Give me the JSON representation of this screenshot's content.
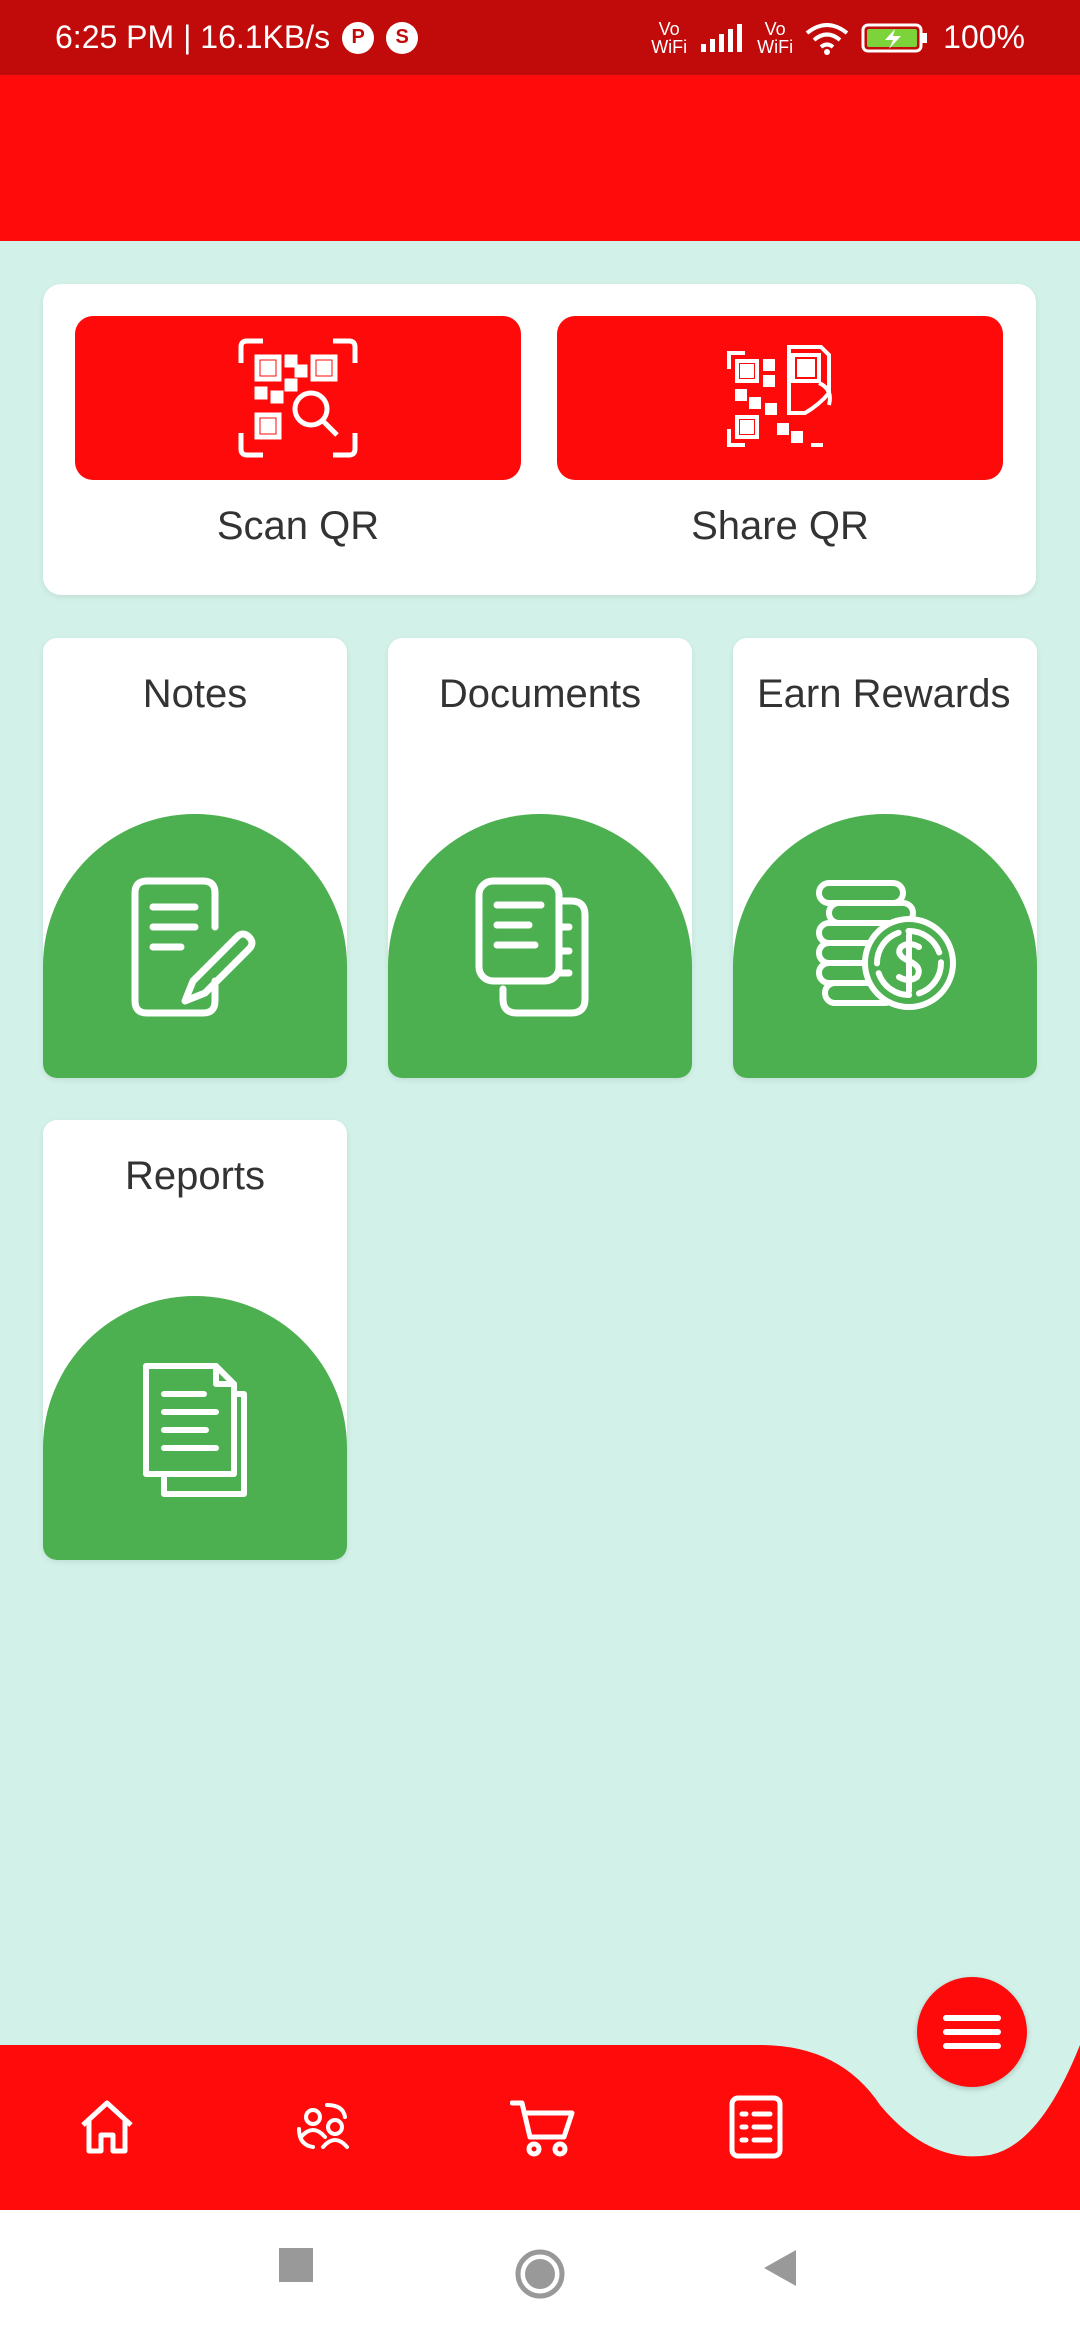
{
  "status_bar": {
    "time_speed": "6:25 PM | 16.1KB/s",
    "notif_icons": [
      "P",
      "S"
    ],
    "vowifi_1": "Vo\nWiFi",
    "vowifi_2": "Vo\nWiFi",
    "battery": "100%"
  },
  "qr_actions": [
    {
      "label": "Scan QR",
      "icon": "qr-scan-icon"
    },
    {
      "label": "Share QR",
      "icon": "qr-share-icon"
    }
  ],
  "tiles": [
    {
      "title": "Notes",
      "icon": "notes-icon"
    },
    {
      "title": "Documents",
      "icon": "documents-icon"
    },
    {
      "title": "Earn Rewards",
      "icon": "coins-icon"
    },
    {
      "title": "Reports",
      "icon": "reports-icon"
    }
  ],
  "bottom_nav": [
    "home-icon",
    "users-exchange-icon",
    "cart-icon",
    "orders-list-icon",
    "menu-icon"
  ],
  "system_nav": [
    "recents-button",
    "home-button",
    "back-button"
  ],
  "colors": {
    "primary_red": "#FF0B0B",
    "status_red": "#C10A0A",
    "green": "#4CAF50",
    "background": "#D2F1E8"
  }
}
